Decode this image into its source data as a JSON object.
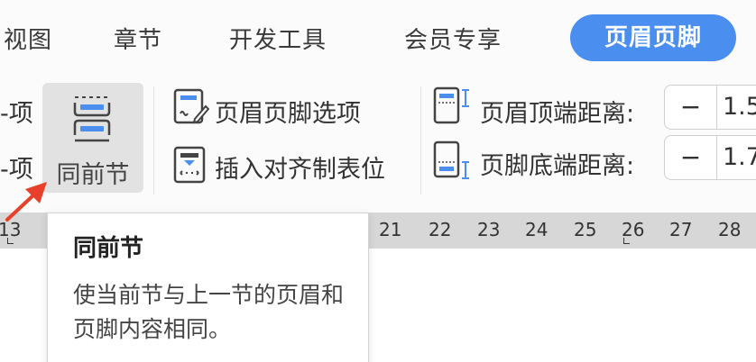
{
  "tabs": {
    "view": "视图",
    "chapter": "章节",
    "devtools": "开发工具",
    "member": "会员专享",
    "header_footer": "页眉页脚"
  },
  "ribbon": {
    "left_item_top": "-项",
    "left_item_bottom": "-项",
    "same_as_previous": "同前节",
    "hf_options": "页眉页脚选项",
    "insert_align_tab": "插入对齐制表位",
    "header_top_distance": "页眉顶端距离:",
    "footer_bottom_distance": "页脚底端距离:",
    "header_value": "1.5",
    "footer_value": "1.7",
    "minus": "−"
  },
  "ruler": {
    "partial_tick": "13",
    "ticks": [
      "21",
      "22",
      "23",
      "24",
      "25",
      "26",
      "27",
      "28"
    ]
  },
  "tooltip": {
    "title": "同前节",
    "body": "使当前节与上一节的页眉和页脚内容相同。"
  },
  "colors": {
    "accent": "#4a8ef0",
    "arrow": "#e8402a"
  }
}
